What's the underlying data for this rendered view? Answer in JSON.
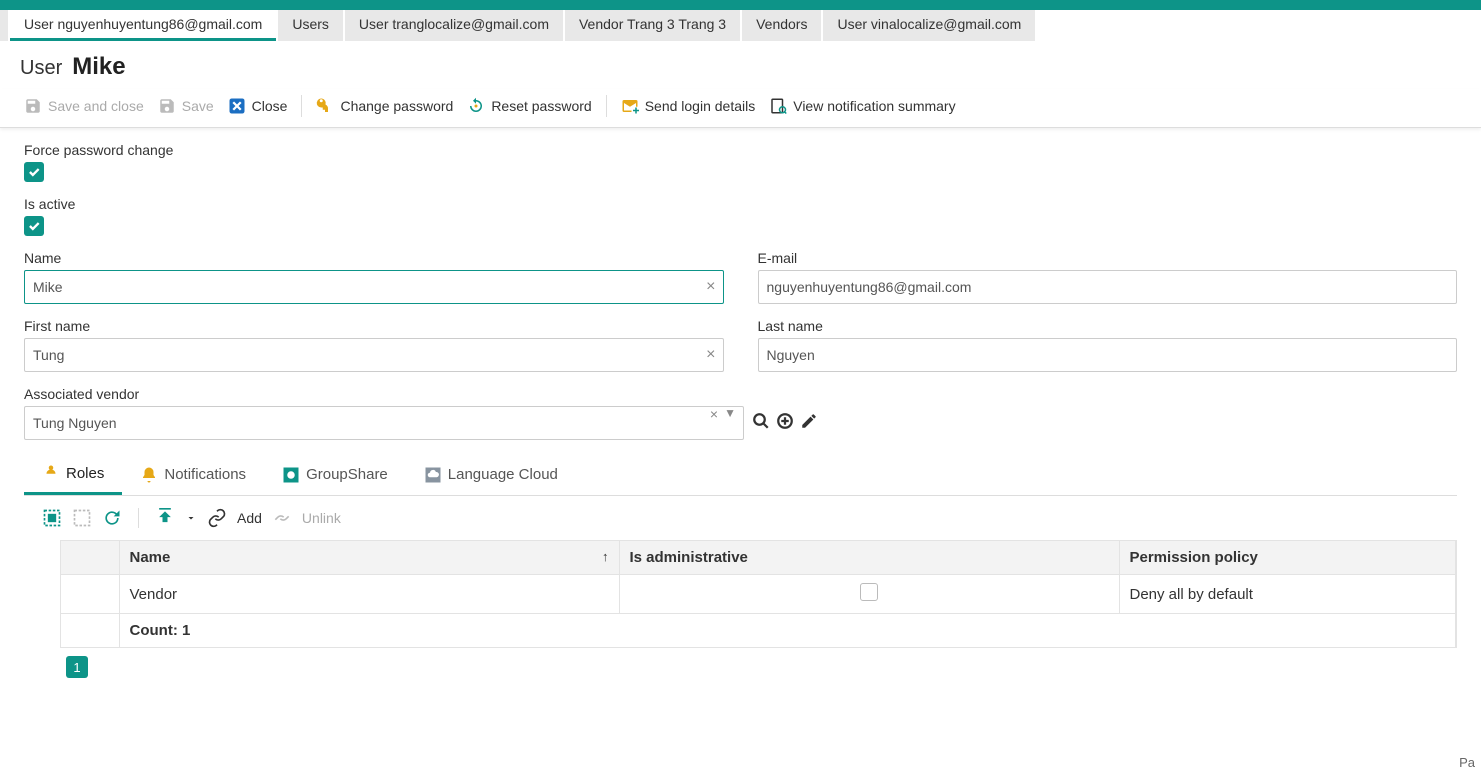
{
  "colors": {
    "accent": "#0d9488"
  },
  "tabs": [
    {
      "label": "User nguyenhuyentung86@gmail.com",
      "active": true
    },
    {
      "label": "Users",
      "active": false
    },
    {
      "label": "User tranglocalize@gmail.com",
      "active": false
    },
    {
      "label": "Vendor Trang 3 Trang 3",
      "active": false
    },
    {
      "label": "Vendors",
      "active": false
    },
    {
      "label": "User vinalocalize@gmail.com",
      "active": false
    }
  ],
  "title": {
    "prefix": "User",
    "name": "Mike"
  },
  "actions": {
    "save_and_close": "Save and close",
    "save": "Save",
    "close": "Close",
    "change_password": "Change password",
    "reset_password": "Reset password",
    "send_login_details": "Send login details",
    "view_notification_summary": "View notification summary"
  },
  "form": {
    "force_password_change": {
      "label": "Force password change",
      "checked": true
    },
    "is_active": {
      "label": "Is active",
      "checked": true
    },
    "name": {
      "label": "Name",
      "value": "Mike"
    },
    "email": {
      "label": "E-mail",
      "value": "nguyenhuyentung86@gmail.com"
    },
    "first_name": {
      "label": "First name",
      "value": "Tung"
    },
    "last_name": {
      "label": "Last name",
      "value": "Nguyen"
    },
    "associated_vendor": {
      "label": "Associated vendor",
      "value": "Tung Nguyen"
    }
  },
  "sub_tabs": [
    {
      "label": "Roles",
      "active": true
    },
    {
      "label": "Notifications",
      "active": false
    },
    {
      "label": "GroupShare",
      "active": false
    },
    {
      "label": "Language Cloud",
      "active": false
    }
  ],
  "grid_toolbar": {
    "add": "Add",
    "unlink": "Unlink"
  },
  "grid": {
    "columns": {
      "name": "Name",
      "is_admin": "Is administrative",
      "policy": "Permission policy"
    },
    "rows": [
      {
        "name": "Vendor",
        "is_admin": false,
        "policy": "Deny all by default"
      }
    ],
    "count_label": "Count: 1"
  },
  "pager": {
    "current": "1"
  },
  "footer": {
    "text": "Pa"
  }
}
